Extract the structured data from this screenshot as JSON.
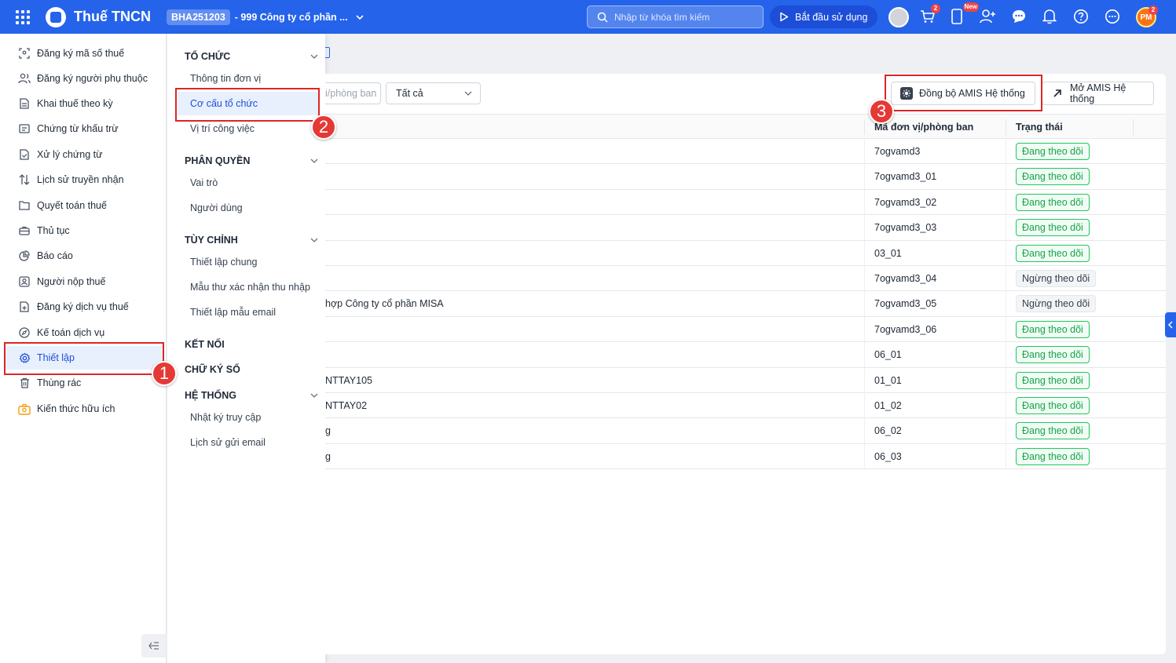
{
  "topbar": {
    "app_title": "Thuế TNCN",
    "company_code": "BHA251203",
    "company_name": "- 999 Công ty cổ phần ...",
    "search_placeholder": "Nhập từ khóa tìm kiếm",
    "start_button": "Bắt đầu sử dụng",
    "cart_badge": "2",
    "new_badge": "New",
    "user_initials": "PM",
    "user_badge": "2"
  },
  "sidebar": {
    "items": [
      {
        "label": "Đăng ký mã số thuế",
        "icon": "scan-icon"
      },
      {
        "label": "Đăng ký người phụ thuộc",
        "icon": "users-icon"
      },
      {
        "label": "Khai thuế theo kỳ",
        "icon": "file-icon"
      },
      {
        "label": "Chứng từ khấu trừ",
        "icon": "receipt-icon"
      },
      {
        "label": "Xử lý chứng từ",
        "icon": "file-check-icon"
      },
      {
        "label": "Lịch sử truyền nhận",
        "icon": "transfer-icon"
      },
      {
        "label": "Quyết toán thuế",
        "icon": "folder-icon"
      },
      {
        "label": "Thủ tục",
        "icon": "briefcase-icon"
      },
      {
        "label": "Báo cáo",
        "icon": "pie-chart-icon"
      },
      {
        "label": "Người nộp thuế",
        "icon": "user-card-icon"
      },
      {
        "label": "Đăng ký dịch vụ thuế",
        "icon": "file-plus-icon"
      },
      {
        "label": "Kế toán dịch vụ",
        "icon": "compass-icon"
      },
      {
        "label": "Thiết lập",
        "icon": "gear-icon"
      },
      {
        "label": "Thùng rác",
        "icon": "trash-icon"
      },
      {
        "label": "Kiến thức hữu ích",
        "icon": "knowledge-icon"
      }
    ]
  },
  "menu": {
    "groups": [
      {
        "title": "TỔ CHỨC",
        "items": [
          "Thông tin đơn vị",
          "Cơ cấu tổ chức",
          "Vị trí công việc"
        ]
      },
      {
        "title": "PHÂN QUYỀN",
        "items": [
          "Vai trò",
          "Người dùng"
        ]
      },
      {
        "title": "TÙY CHỈNH",
        "items": [
          "Thiết lập chung",
          "Mẫu thư xác nhận thu nhập",
          "Thiết lập mẫu email"
        ]
      },
      {
        "title": "KẾT NỐI",
        "items": []
      },
      {
        "title": "CHỮ KÝ SỐ",
        "items": []
      },
      {
        "title": "HỆ THỐNG",
        "items": [
          "Nhật ký truy cập",
          "Lịch sử gửi email"
        ]
      }
    ]
  },
  "toolbar": {
    "unit_search_placeholder_partial": "i/phòng ban",
    "status_filter_value": "Tất cả",
    "sync_button": "Đồng bộ AMIS Hệ thống",
    "open_button": "Mở AMIS Hệ thống"
  },
  "table": {
    "headers": [
      "Mã đơn vị/phòng ban",
      "Trạng thái"
    ],
    "rows": [
      {
        "name": "",
        "code": "7ogvamd3",
        "status": "Đang theo dõi",
        "active": true
      },
      {
        "name": "",
        "code": "7ogvamd3_01",
        "status": "Đang theo dõi",
        "active": true
      },
      {
        "name": "",
        "code": "7ogvamd3_02",
        "status": "Đang theo dõi",
        "active": true
      },
      {
        "name": "",
        "code": "7ogvamd3_03",
        "status": "Đang theo dõi",
        "active": true
      },
      {
        "name": "",
        "code": "03_01",
        "status": "Đang theo dõi",
        "active": true
      },
      {
        "name": "",
        "code": "7ogvamd3_04",
        "status": "Ngừng theo dõi",
        "active": false
      },
      {
        "name": "hợp Công ty cổ phần MISA",
        "code": "7ogvamd3_05",
        "status": "Ngừng theo dõi",
        "active": false
      },
      {
        "name": "",
        "code": "7ogvamd3_06",
        "status": "Đang theo dõi",
        "active": true
      },
      {
        "name": "",
        "code": "06_01",
        "status": "Đang theo dõi",
        "active": true
      },
      {
        "name": "NTTAY105",
        "code": "01_01",
        "status": "Đang theo dõi",
        "active": true
      },
      {
        "name": "NTTAY02",
        "code": "01_02",
        "status": "Đang theo dõi",
        "active": true
      },
      {
        "name": "g",
        "code": "06_02",
        "status": "Đang theo dõi",
        "active": true
      },
      {
        "name": "g",
        "code": "06_03",
        "status": "Đang theo dõi",
        "active": true
      }
    ]
  },
  "annotations": {
    "step1": "1",
    "step2": "2",
    "step3": "3"
  },
  "colors": {
    "primary": "#2563eb",
    "highlight": "#dc2626",
    "status_active": "#16a34a"
  }
}
